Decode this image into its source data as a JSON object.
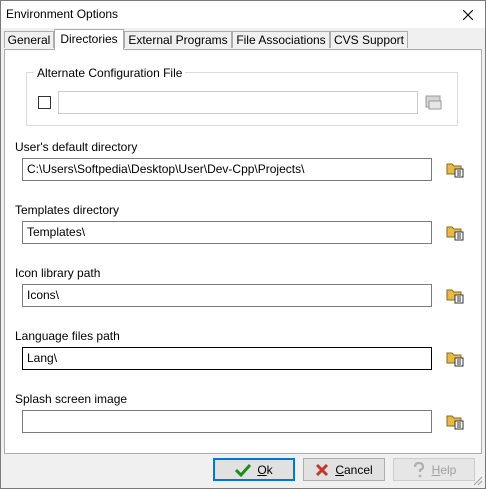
{
  "window": {
    "title": "Environment Options"
  },
  "tabs": [
    {
      "label": "General"
    },
    {
      "label": "Directories"
    },
    {
      "label": "External Programs"
    },
    {
      "label": "File Associations"
    },
    {
      "label": "CVS Support"
    }
  ],
  "alt_config": {
    "group_label": "Alternate Configuration File",
    "checked": false,
    "value": ""
  },
  "fields": {
    "default_dir": {
      "label": "User's default directory",
      "value": "C:\\Users\\Softpedia\\Desktop\\User\\Dev-Cpp\\Projects\\"
    },
    "templates_dir": {
      "label": "Templates directory",
      "value": "Templates\\"
    },
    "icon_path": {
      "label": "Icon library path",
      "value": "Icons\\"
    },
    "lang_path": {
      "label": "Language files path",
      "value": "Lang\\"
    },
    "splash_image": {
      "label": "Splash screen image",
      "value": ""
    }
  },
  "buttons": {
    "ok": {
      "prefix": "",
      "mnemonic": "O",
      "rest": "k"
    },
    "cancel": {
      "prefix": "",
      "mnemonic": "C",
      "rest": "ancel"
    },
    "help": {
      "prefix": "",
      "mnemonic": "H",
      "rest": "elp"
    }
  },
  "icons": {
    "close": "close-icon",
    "browse": "folder-browse-icon",
    "ok": "checkmark-icon",
    "cancel": "cross-icon",
    "help": "question-icon"
  },
  "colors": {
    "accent": "#0078d7",
    "ok_green": "#1f8a1f",
    "cancel_red": "#c0392b",
    "folder": "#e8b84a"
  }
}
